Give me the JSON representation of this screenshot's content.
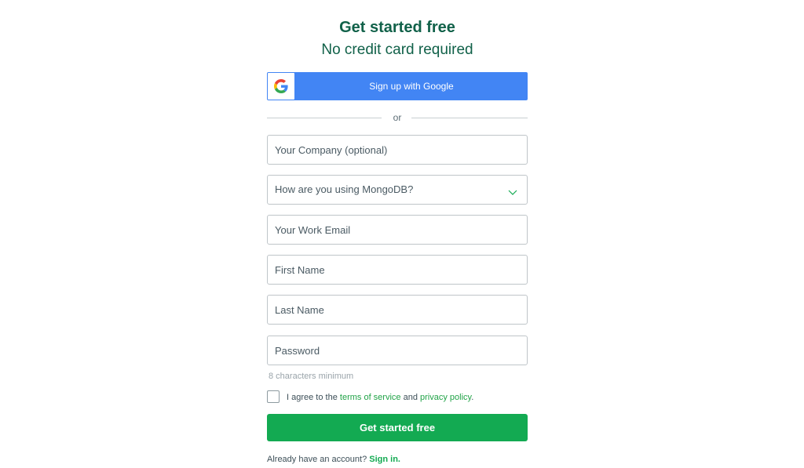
{
  "header": {
    "title": "Get started free",
    "subtitle": "No credit card required"
  },
  "google": {
    "label": "Sign up with Google",
    "icon": "google-g-icon",
    "color": "#4285f4"
  },
  "divider": {
    "text": "or"
  },
  "form": {
    "company_placeholder": "Your Company (optional)",
    "usage_select": "How are you using MongoDB?",
    "email_placeholder": "Your Work Email",
    "first_name_placeholder": "First Name",
    "last_name_placeholder": "Last Name",
    "password_placeholder": "Password",
    "password_hint": "8 characters minimum"
  },
  "agreement": {
    "prefix": "I agree to the",
    "terms_link": "terms of service",
    "and": "and",
    "privacy_link": "privacy policy",
    "suffix": "."
  },
  "submit": {
    "label": "Get started free",
    "color": "#13aa52"
  },
  "signin": {
    "prefix": "Already have an account?",
    "link": "Sign in."
  },
  "colors": {
    "brand_green": "#116149",
    "link_green": "#21a347"
  }
}
